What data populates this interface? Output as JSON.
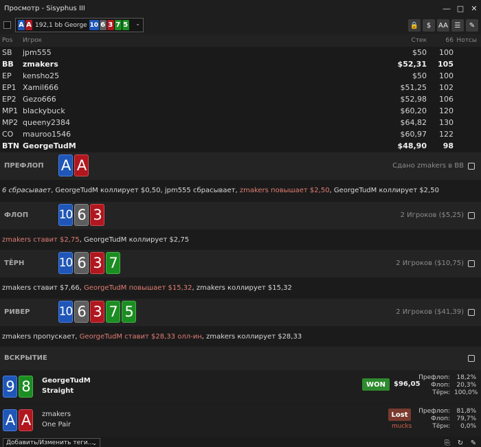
{
  "window": {
    "title": "Просмотр - Sisyphus III",
    "min_icon": "minimize-icon",
    "max_icon": "maximize-icon",
    "close_icon": "close-icon"
  },
  "toolbar": {
    "hand_selector": {
      "hole_cards": [
        {
          "rank": "A",
          "color": "#1f56b8"
        },
        {
          "rank": "A",
          "color": "#b0171f"
        }
      ],
      "summary": "192,1 bb George",
      "board": [
        {
          "rank": "10",
          "color": "#1f56b8"
        },
        {
          "rank": "6",
          "color": "#5d5d5d"
        },
        {
          "rank": "3",
          "color": "#b0171f"
        },
        {
          "rank": "7",
          "color": "#1c8d22"
        },
        {
          "rank": "5",
          "color": "#1c8d22"
        }
      ]
    },
    "buttons": [
      {
        "name": "hide-names-button",
        "icon": "lock-icon",
        "glyph": "🔒"
      },
      {
        "name": "currency-button",
        "icon": "dollar-icon",
        "glyph": "$"
      },
      {
        "name": "font-size-button",
        "icon": "font-size-icon",
        "glyph": "AA"
      },
      {
        "name": "list-view-button",
        "icon": "list-icon",
        "glyph": "☰"
      },
      {
        "name": "edit-button",
        "icon": "pencil-icon",
        "glyph": "✎"
      }
    ]
  },
  "players": {
    "headers": {
      "pos": "Pos",
      "name": "Игрок",
      "stack": "Стек",
      "vpip": "66",
      "notes": "Нотсы"
    },
    "rows": [
      {
        "pos": "SB",
        "name": "jpm555",
        "stack": "$50",
        "vpip": "100",
        "bold": false
      },
      {
        "pos": "BB",
        "name": "zmakers",
        "stack": "$52,31",
        "vpip": "105",
        "bold": true
      },
      {
        "pos": "EP",
        "name": "kensho25",
        "stack": "$50",
        "vpip": "100",
        "bold": false
      },
      {
        "pos": "EP1",
        "name": "Xamil666",
        "stack": "$51,25",
        "vpip": "102",
        "bold": false
      },
      {
        "pos": "EP2",
        "name": "Gezo666",
        "stack": "$52,98",
        "vpip": "106",
        "bold": false
      },
      {
        "pos": "MP1",
        "name": "blackybuck",
        "stack": "$60,20",
        "vpip": "120",
        "bold": false
      },
      {
        "pos": "MP2",
        "name": "queeny2384",
        "stack": "$64,82",
        "vpip": "130",
        "bold": false
      },
      {
        "pos": "CO",
        "name": "mauroo1546",
        "stack": "$60,97",
        "vpip": "122",
        "bold": false
      },
      {
        "pos": "BTN",
        "name": "GeorgeTudM",
        "stack": "$48,90",
        "vpip": "98",
        "bold": true
      }
    ]
  },
  "streets": {
    "preflop": {
      "name": "ПРЕФЛОП",
      "cards": [
        {
          "rank": "A",
          "color": "blue"
        },
        {
          "rank": "A",
          "color": "red"
        }
      ],
      "info": "Сдано zmakers в BB",
      "actions": [
        {
          "text": "6 сбрасывает",
          "style": "fold"
        },
        {
          "text": ", GeorgeTudM коллирует $0,50, jpm555 сбрасывает, ",
          "style": "normal"
        },
        {
          "text": "zmakers повышает $2,50",
          "style": "agg"
        },
        {
          "text": ", GeorgeTudM коллирует $2,50",
          "style": "normal"
        }
      ]
    },
    "flop": {
      "name": "ФЛОП",
      "cards": [
        {
          "rank": "10",
          "color": "blue"
        },
        {
          "rank": "6",
          "color": "grey"
        },
        {
          "rank": "3",
          "color": "red"
        }
      ],
      "info": "2 Игроков ($5,25)",
      "actions": [
        {
          "text": "zmakers ставит $2,75",
          "style": "agg"
        },
        {
          "text": ", GeorgeTudM коллирует $2,75",
          "style": "normal"
        }
      ]
    },
    "turn": {
      "name": "ТЁРН",
      "cards": [
        {
          "rank": "10",
          "color": "blue"
        },
        {
          "rank": "6",
          "color": "grey"
        },
        {
          "rank": "3",
          "color": "red"
        },
        {
          "rank": "7",
          "color": "green"
        }
      ],
      "info": "2 Игроков ($10,75)",
      "actions": [
        {
          "text": "zmakers ставит $7,66, ",
          "style": "normal"
        },
        {
          "text": "GeorgeTudM повышает $15,32",
          "style": "agg"
        },
        {
          "text": ", zmakers коллирует $15,32",
          "style": "normal"
        }
      ]
    },
    "river": {
      "name": "РИВЕР",
      "cards": [
        {
          "rank": "10",
          "color": "blue"
        },
        {
          "rank": "6",
          "color": "grey"
        },
        {
          "rank": "3",
          "color": "red"
        },
        {
          "rank": "7",
          "color": "green"
        },
        {
          "rank": "5",
          "color": "green"
        }
      ],
      "info": "2 Игроков ($41,39)",
      "actions": [
        {
          "text": "zmakers пропускает, ",
          "style": "normal"
        },
        {
          "text": "GeorgeTudM ставит $28,33 олл-ин",
          "style": "agg"
        },
        {
          "text": ", zmakers коллирует $28,33",
          "style": "normal"
        }
      ]
    }
  },
  "showdown": {
    "name": "ВСКРЫТИЕ",
    "winner": {
      "cards": [
        {
          "rank": "9",
          "color": "blue"
        },
        {
          "rank": "8",
          "color": "green"
        }
      ],
      "player": "GeorgeTudM",
      "hand": "Straight",
      "badge": "WON",
      "amount": "$96,05",
      "equity": [
        {
          "label": "Префлоп:",
          "value": "18,2%"
        },
        {
          "label": "Флоп:",
          "value": "20,3%"
        },
        {
          "label": "Тёрн:",
          "value": "100,0%"
        }
      ]
    },
    "loser": {
      "cards": [
        {
          "rank": "A",
          "color": "blue"
        },
        {
          "rank": "A",
          "color": "red"
        }
      ],
      "player": "zmakers",
      "hand": "One Pair",
      "badge": "Lost",
      "note": "mucks",
      "equity": [
        {
          "label": "Префлоп:",
          "value": "81,8%"
        },
        {
          "label": "Флоп:",
          "value": "79,7%"
        },
        {
          "label": "Тёрн:",
          "value": "0,0%"
        }
      ]
    }
  },
  "bottom": {
    "tags_label": "Добавить/Изменить теги...",
    "buttons": [
      {
        "name": "copy-button",
        "icon": "copy-icon",
        "glyph": "⎘"
      },
      {
        "name": "replay-button",
        "icon": "refresh-icon",
        "glyph": "↻"
      },
      {
        "name": "edit-hand-button",
        "icon": "pencil-icon",
        "glyph": "✎"
      }
    ]
  }
}
